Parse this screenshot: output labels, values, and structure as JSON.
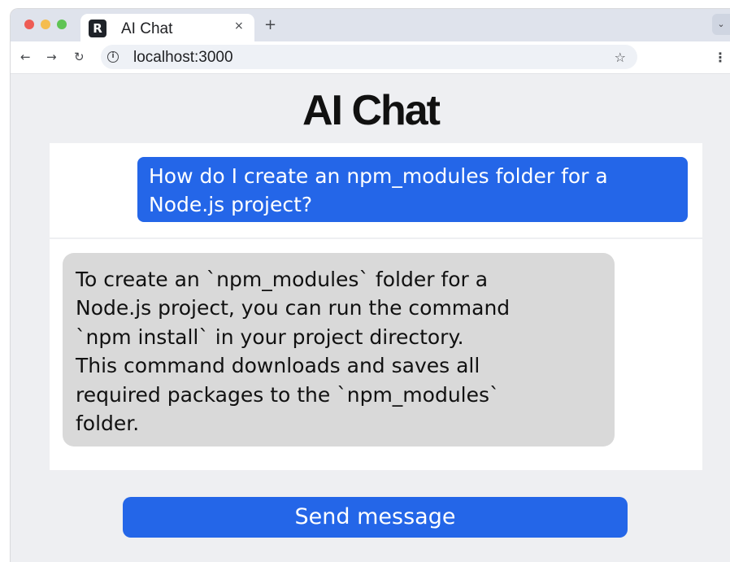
{
  "browser": {
    "tab": {
      "title": "AI Chat",
      "favicon_letter": "R",
      "close_glyph": "×"
    },
    "new_tab_glyph": "+",
    "tab_menu_glyph": "⌄",
    "nav": {
      "back": "←",
      "forward": "→",
      "reload": "↻"
    },
    "address": {
      "url": "localhost:3000"
    },
    "icons": {
      "info": "i",
      "star": "☆",
      "menu": "⋮"
    }
  },
  "page": {
    "title": "AI Chat",
    "messages": [
      {
        "role": "user",
        "text": "How do I create an npm_modules folder for a Node.js project?"
      },
      {
        "role": "assistant",
        "text": "To create an `npm_modules` folder for a\nNode.js project, you can run the command\n`npm install` in your project directory.\nThis command downloads and saves all\nrequired packages to the `npm_modules`\nfolder."
      }
    ],
    "send_button_label": "Send message"
  },
  "colors": {
    "accent": "#2466e8",
    "assistant_bubble": "#d9d9d9",
    "page_background": "#eeeff2"
  }
}
